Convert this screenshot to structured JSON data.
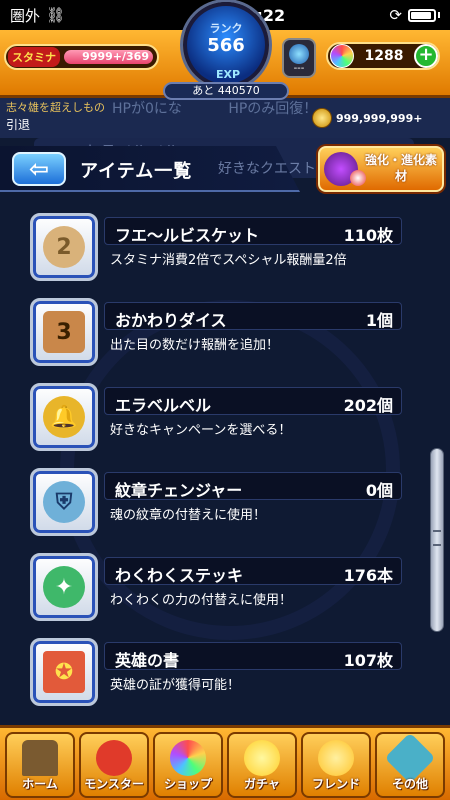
{
  "status_bar": {
    "carrier": "圏外",
    "time": "12:22"
  },
  "hud": {
    "stamina_label": "スタミナ",
    "stamina_current": "9999+",
    "stamina_max": "/369",
    "rank_label": "ランク",
    "rank_value": "566",
    "exp_label": "EXP",
    "exp_remaining": "あと 440570",
    "gem_placeholder": "---",
    "orb_count": "1288",
    "coin_amount": "999,999,999+"
  },
  "strip": {
    "line1": "志々雄を超えしもの",
    "line2": "引退",
    "ghost_text": "HPが0にな　　　 HPのみ回復！"
  },
  "page": {
    "ghost_row_title": "トラベルベル",
    "title": "アイテム一覧",
    "ghost_subtitle": "好きなクエスト",
    "evolve_button_label": "強化・進化素材"
  },
  "items": [
    {
      "name": "フエ〜ルビスケット",
      "count": "110枚",
      "desc": "スタミナ消費2倍でスペシャル報酬量2倍",
      "icon": "biscuit-icon",
      "color": "#d9b27a"
    },
    {
      "name": "おかわりダイス",
      "count": "1個",
      "desc": "出た目の数だけ報酬を追加！",
      "icon": "dice-icon",
      "color": "#c9874a"
    },
    {
      "name": "エラベルベル",
      "count": "202個",
      "desc": "好きなキャンペーンを選べる！",
      "icon": "bell-icon",
      "color": "#e8b52a"
    },
    {
      "name": "紋章チェンジャー",
      "count": "0個",
      "desc": "魂の紋章の付替えに使用！",
      "icon": "emblem-changer-icon",
      "color": "#6fb0d8"
    },
    {
      "name": "わくわくステッキ",
      "count": "176本",
      "desc": "わくわくの力の付替えに使用！",
      "icon": "wand-icon",
      "color": "#3fb86a"
    },
    {
      "name": "英雄の書",
      "count": "107枚",
      "desc": "英雄の証が獲得可能！",
      "icon": "hero-book-icon",
      "color": "#e25a3a"
    }
  ],
  "bottom_nav": [
    {
      "label": "ホーム",
      "icon": "home-icon",
      "color": "#7a5a30"
    },
    {
      "label": "モンスター",
      "icon": "monster-icon",
      "color": "#e03a2a"
    },
    {
      "label": "ショップ",
      "icon": "shop-orb-icon",
      "color": "#b05aff"
    },
    {
      "label": "ガチャ",
      "icon": "gacha-icon",
      "color": "#ffe04a"
    },
    {
      "label": "フレンド",
      "icon": "friend-icon",
      "color": "#ffd24a"
    },
    {
      "label": "その他",
      "icon": "other-icon",
      "color": "#4ab0c8"
    }
  ]
}
